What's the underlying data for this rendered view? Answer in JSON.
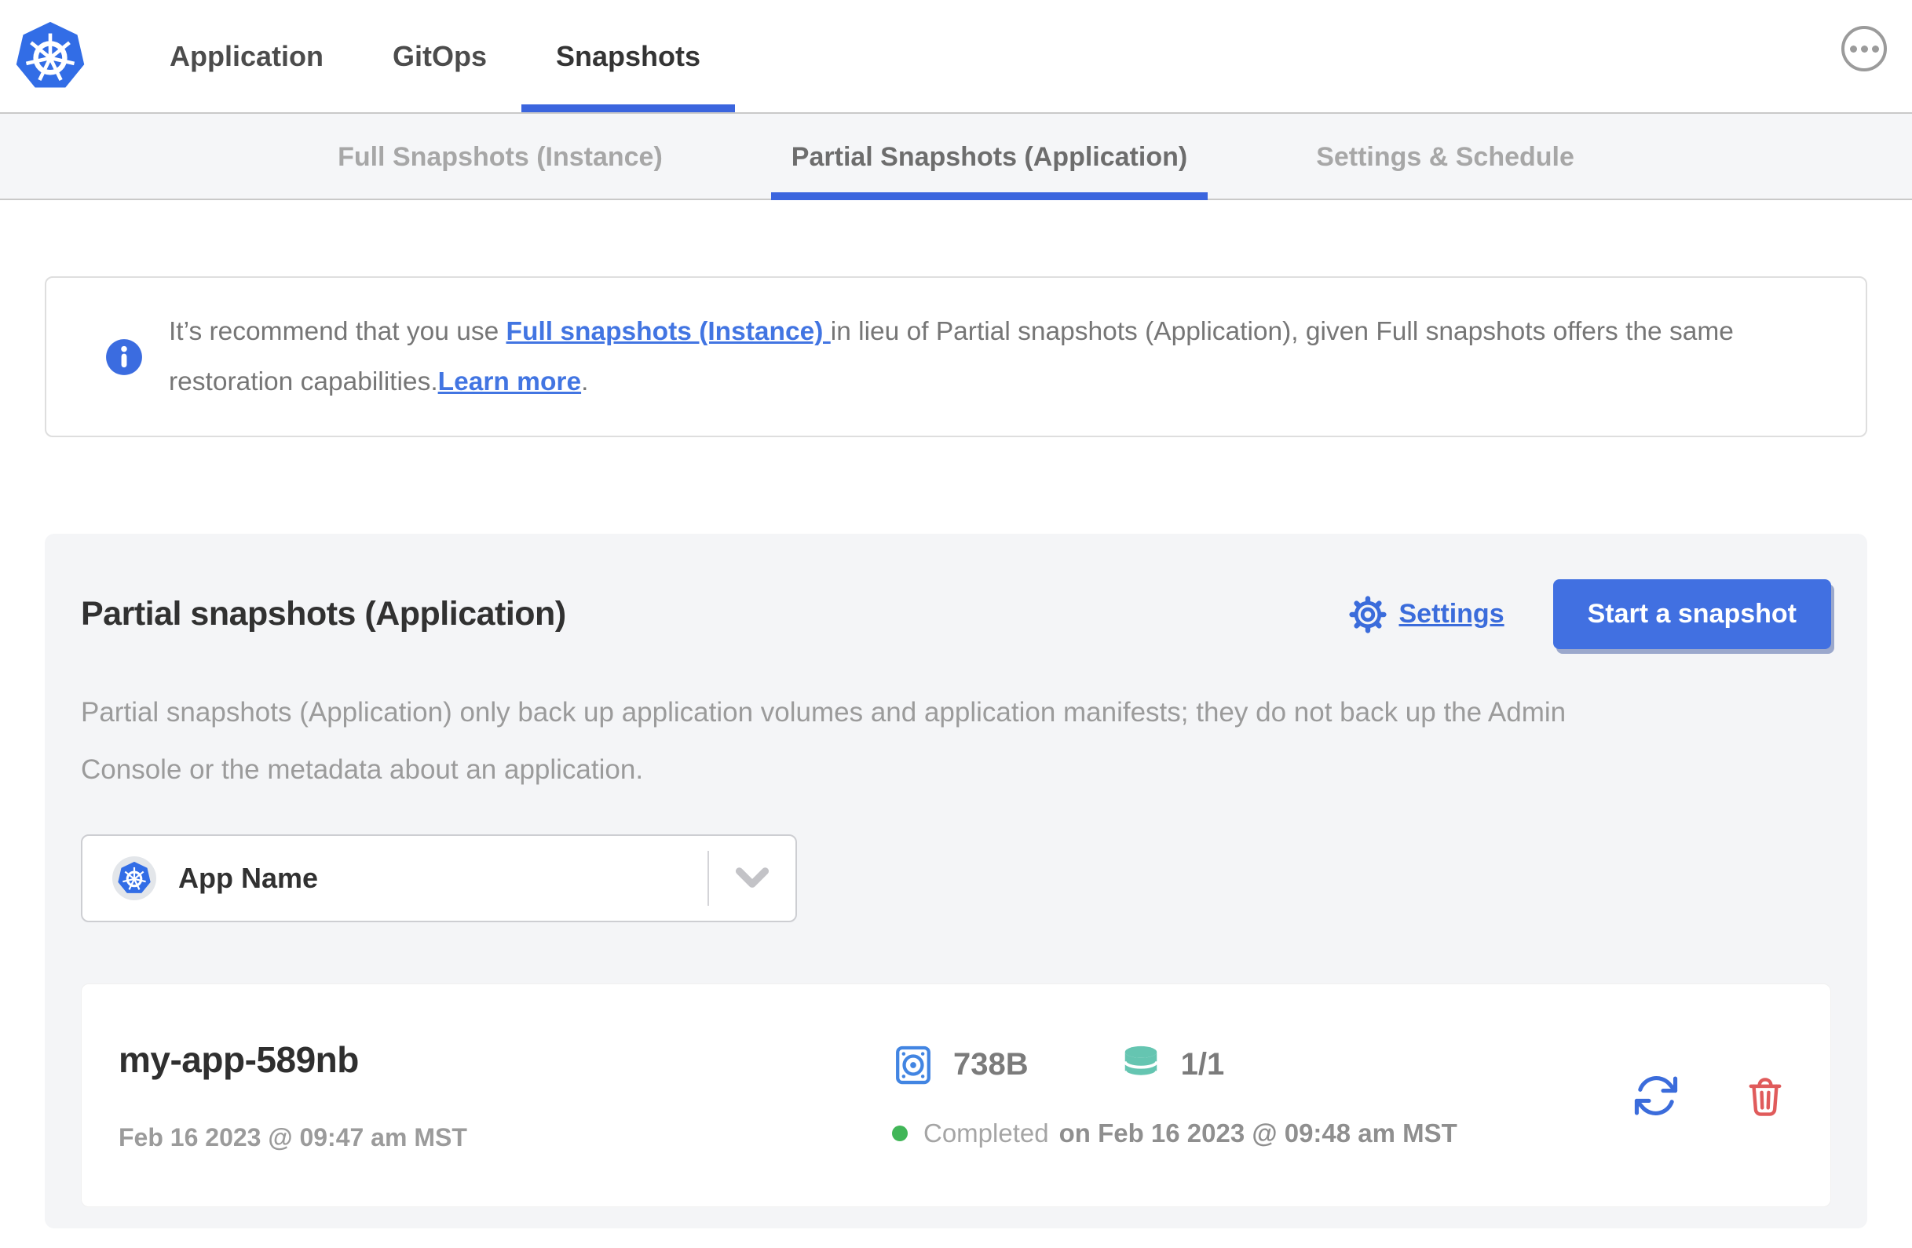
{
  "nav": {
    "tabs": [
      {
        "label": "Application"
      },
      {
        "label": "GitOps"
      },
      {
        "label": "Snapshots"
      }
    ],
    "active_tab": "Snapshots"
  },
  "subnav": {
    "tabs": [
      {
        "label": "Full Snapshots (Instance)"
      },
      {
        "label": "Partial Snapshots (Application)"
      },
      {
        "label": "Settings & Schedule"
      }
    ],
    "active_tab": "Partial Snapshots (Application)"
  },
  "banner": {
    "icon": "info-icon",
    "text_start": "It’s recommend that you use ",
    "link_full_snapshots": "Full snapshots (Instance) ",
    "text_middle": "in lieu of Partial snapshots (Application), given Full snapshots offers the same restoration capabilities.",
    "link_learn_more": "Learn more",
    "text_end": "."
  },
  "panel": {
    "title": "Partial snapshots (Application)",
    "settings_link": "Settings",
    "start_snapshot_button": "Start a snapshot",
    "description": "Partial snapshots (Application) only back up application volumes and application manifests; they do not back up the Admin Console or the metadata about an application.",
    "app_selector": {
      "selected": "App Name"
    }
  },
  "snapshots": [
    {
      "name": "my-app-589nb",
      "started_at": "Feb 16 2023 @ 09:47 am MST",
      "size": "738B",
      "volumes": "1/1",
      "status": "Completed",
      "completed_at": "on Feb 16 2023 @ 09:48 am MST"
    }
  ],
  "colors": {
    "kubernetes_blue": "#326de6",
    "accent_underline": "#3b65de",
    "link_blue": "#4275e2",
    "button_blue": "#4170e1",
    "volume_teal": "#65c5b1",
    "success_green": "#41b658",
    "danger_red": "#e05b5b"
  }
}
